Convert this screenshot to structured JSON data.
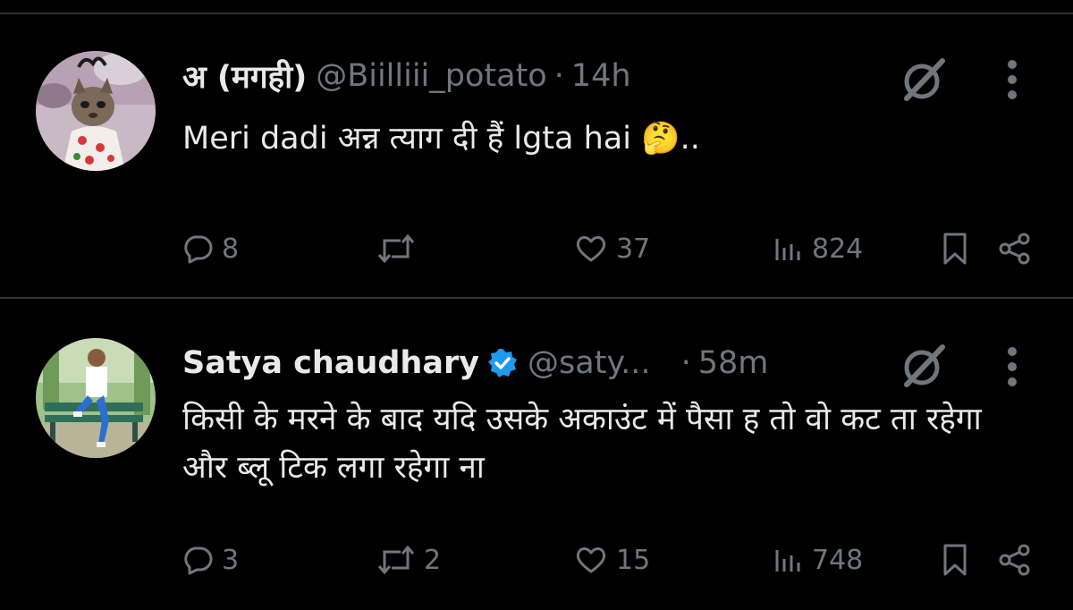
{
  "tweets": [
    {
      "display_name": "अ (मगही)",
      "handle": "@Biilliii_potato",
      "separator": "·",
      "time": "14h",
      "verified": false,
      "text": "Meri dadi अन्न त्याग दी हैं lgta hai 🤔..",
      "avatar_icon": "cat-avatar",
      "actions": {
        "replies": "8",
        "reposts": "",
        "likes": "37",
        "views": "824"
      }
    },
    {
      "display_name": "Satya chaudhary",
      "handle": "@saty...",
      "separator": "·",
      "time": "58m",
      "verified": true,
      "text": "किसी के मरने के बाद यदि उसके अकाउंट में पैसा ह तो वो कट ता रहेगा और ब्लू टिक लगा रहेगा ना",
      "avatar_icon": "person-on-bench-avatar",
      "actions": {
        "replies": "3",
        "reposts": "2",
        "likes": "15",
        "views": "748"
      }
    }
  ],
  "colors": {
    "background": "#000000",
    "primary_text": "#e7e9ea",
    "secondary_text": "#71767b",
    "divider": "#2f3336",
    "verified_badge": "#1d9bf0"
  }
}
